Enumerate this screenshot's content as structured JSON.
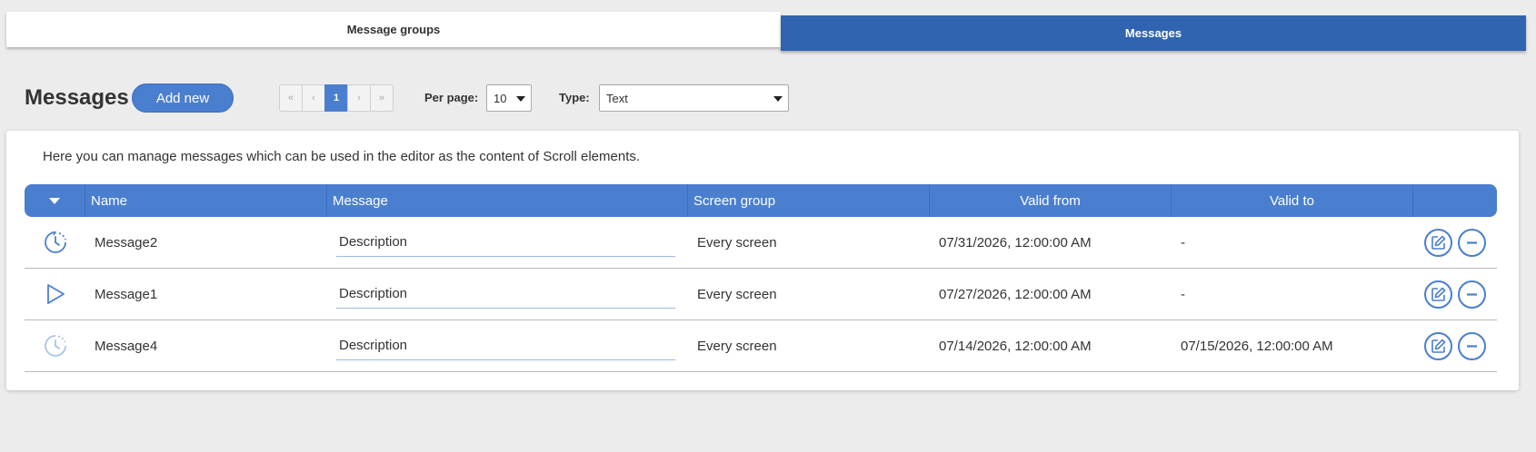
{
  "tabs": {
    "message_groups": "Message groups",
    "messages": "Messages"
  },
  "toolbar": {
    "title": "Messages",
    "add_new": "Add new",
    "pager": [
      "«",
      "‹",
      "1",
      "›",
      "»"
    ],
    "current_page": "1",
    "per_page_label": "Per page:",
    "per_page_value": "10",
    "type_label": "Type:",
    "type_value": "Text"
  },
  "panel": {
    "description": "Here you can manage messages which can be used in the editor as the content of Scroll elements."
  },
  "table": {
    "columns": [
      "Name",
      "Message",
      "Screen group",
      "Valid from",
      "Valid to"
    ],
    "rows": [
      {
        "status_icon": "scheduled-clock-icon",
        "name": "Message2",
        "message": "Description",
        "screen_group": "Every screen",
        "valid_from": "07/31/2026, 12:00:00 AM",
        "valid_to": "-"
      },
      {
        "status_icon": "play-icon",
        "name": "Message1",
        "message": "Description",
        "screen_group": "Every screen",
        "valid_from": "07/27/2026, 12:00:00 AM",
        "valid_to": "-"
      },
      {
        "status_icon": "expired-clock-icon",
        "name": "Message4",
        "message": "Description",
        "screen_group": "Every screen",
        "valid_from": "07/14/2026, 12:00:00 AM",
        "valid_to": "07/15/2026, 12:00:00 AM"
      }
    ]
  },
  "colors": {
    "accent": "#4a7fcf",
    "active_tab": "#3063b0",
    "background": "#ececec"
  }
}
